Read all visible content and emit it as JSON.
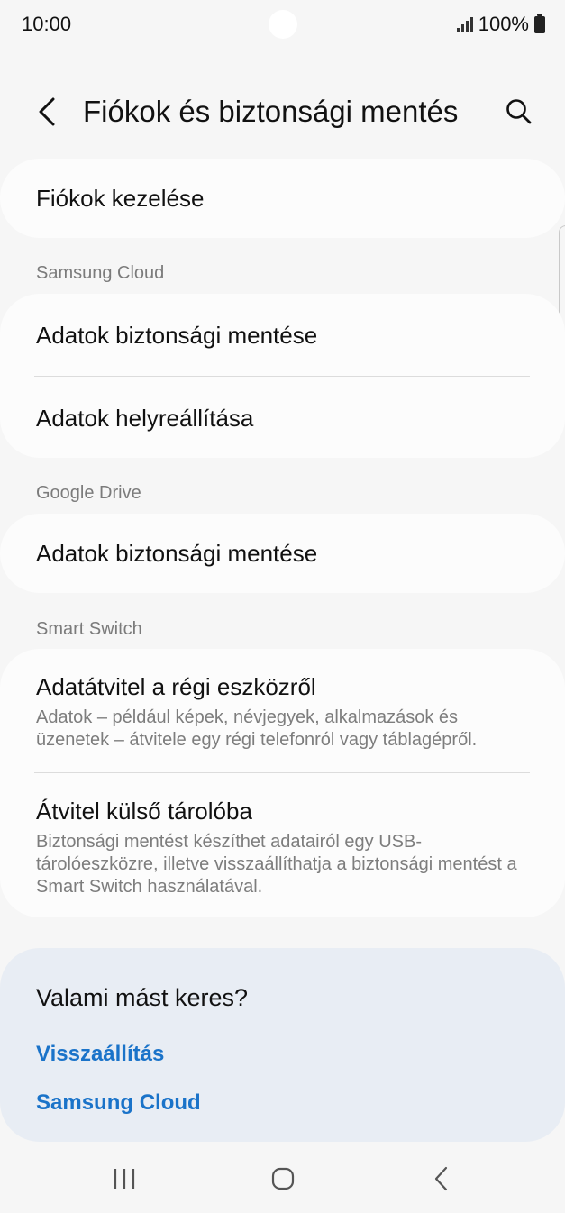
{
  "status_bar": {
    "time": "10:00",
    "battery": "100%"
  },
  "header": {
    "title": "Fiókok és biztonsági mentés"
  },
  "accounts": {
    "manage": "Fiókok kezelése"
  },
  "samsung_cloud": {
    "label": "Samsung Cloud",
    "backup": "Adatok biztonsági mentése",
    "restore": "Adatok helyreállítása"
  },
  "google_drive": {
    "label": "Google Drive",
    "backup": "Adatok biztonsági mentése"
  },
  "smart_switch": {
    "label": "Smart Switch",
    "transfer_title": "Adatátvitel a régi eszközről",
    "transfer_desc": "Adatok – például képek, névjegyek, alkalmazások és üzenetek – átvitele egy régi telefonról vagy táblagépről.",
    "external_title": "Átvitel külső tárolóba",
    "external_desc": "Biztonsági mentést készíthet adatairól egy USB-tárolóeszközre, illetve visszaállíthatja a biztonsági mentést a Smart Switch használatával."
  },
  "suggestions": {
    "title": "Valami mást keres?",
    "links": [
      "Visszaállítás",
      "Samsung Cloud"
    ]
  },
  "colors": {
    "link": "#1a73c9",
    "background": "#f6f6f6",
    "card": "#fcfcfc",
    "suggest_bg": "#e8edf4"
  },
  "icons": [
    "back-arrow-icon",
    "search-icon",
    "recents-icon",
    "home-icon",
    "nav-back-icon"
  ]
}
